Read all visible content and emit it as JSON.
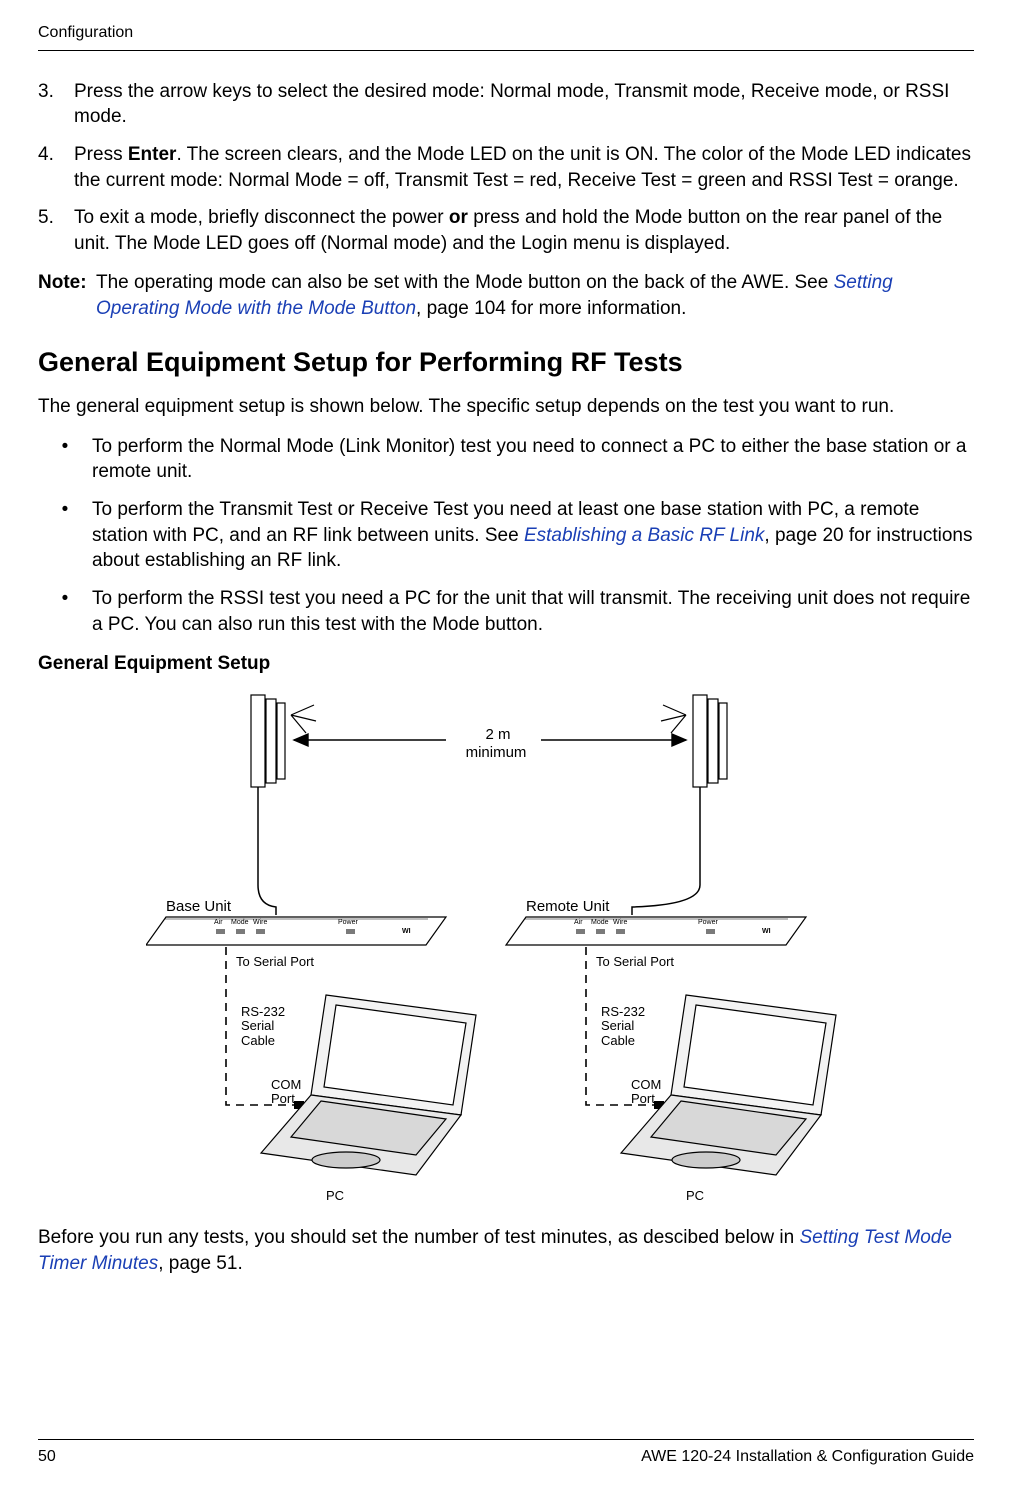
{
  "header": {
    "running": "Configuration"
  },
  "steps": {
    "items": [
      {
        "num": "3.",
        "text_a": "Press the arrow keys to select the desired mode: Normal mode, Transmit mode, Receive mode, or RSSI mode."
      },
      {
        "num": "4.",
        "text_a": "Press ",
        "bold": "Enter",
        "text_b": ". The screen clears, and the Mode LED on the unit is ON. The color of the Mode LED indicates the current mode: Normal Mode = off, Transmit Test = red, Receive Test = green and RSSI Test = orange."
      },
      {
        "num": "5.",
        "text_a": "To exit a mode, briefly disconnect the power ",
        "bold": "or",
        "text_b": " press and hold the Mode button on the rear panel of the unit. The Mode LED goes off (Normal mode) and the Login menu is displayed."
      }
    ]
  },
  "note": {
    "label": "Note:",
    "text_a": "The operating mode can also be set with the Mode button on the back of the AWE. See ",
    "link": "Setting Operating Mode with the Mode Button",
    "text_b": ", page 104 for more information."
  },
  "section": {
    "heading": "General Equipment Setup for Performing RF Tests",
    "lead": "The general equipment setup is shown below. The specific setup depends on the test you want to run.",
    "bullets": [
      {
        "text_a": "To perform the Normal Mode (Link Monitor) test you need to connect a PC to either the base station or a remote unit."
      },
      {
        "text_a": "To perform the Transmit Test or Receive Test you need at least one base station with PC, a remote station with PC, and an RF link between units. See ",
        "link": "Establishing a Basic RF Link",
        "text_b": ", page 20 for instructions about establishing an RF link."
      },
      {
        "text_a": "To perform the RSSI test you need a PC for the unit that will transmit. The receiving unit does not require a PC. You can also run this test with the Mode button."
      }
    ]
  },
  "figure": {
    "title": "General Equipment Setup",
    "distance_top": "2 m",
    "distance_bottom": "minimum",
    "base_label": "Base Unit",
    "remote_label": "Remote Unit",
    "serial_port": "To Serial Port",
    "rs232_l1": "RS-232",
    "rs232_l2": "Serial",
    "rs232_l3": "Cable",
    "com_l1": "COM",
    "com_l2": "Port",
    "pc": "PC",
    "unit_air": "Air",
    "unit_mode": "Mode",
    "unit_wire": "Wire",
    "unit_power": "Power"
  },
  "after_fig": {
    "text_a": "Before you run any tests, you should set the number of test minutes, as descibed below in ",
    "link": "Setting Test Mode Timer Minutes",
    "text_b": ", page 51."
  },
  "footer": {
    "page": "50",
    "doc": "AWE 120-24 Installation & Configuration Guide"
  }
}
